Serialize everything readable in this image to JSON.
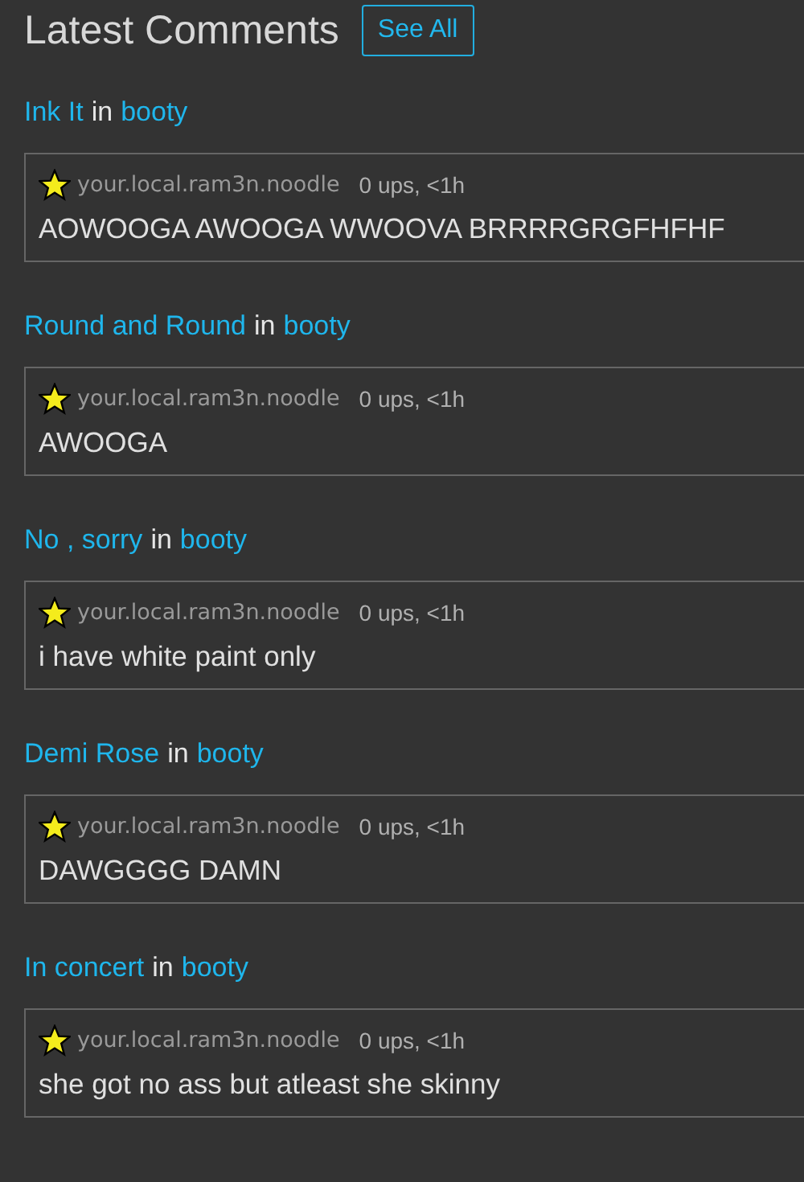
{
  "header": {
    "title": "Latest Comments",
    "button": "See All"
  },
  "comments": [
    {
      "meme_title": "Ink It",
      "joiner": "in",
      "stream": "booty",
      "user": "your.local.ram3n.noodle",
      "meta": "0 ups, <1h",
      "text": "AOWOOGA AWOOGA WWOOVA BRRRRGRGFHFHF"
    },
    {
      "meme_title": "Round and Round",
      "joiner": "in",
      "stream": "booty",
      "user": "your.local.ram3n.noodle",
      "meta": "0 ups, <1h",
      "text": "AWOOGA"
    },
    {
      "meme_title": "No , sorry",
      "joiner": "in",
      "stream": "booty",
      "user": "your.local.ram3n.noodle",
      "meta": "0 ups, <1h",
      "text": "i have white paint only"
    },
    {
      "meme_title": "Demi Rose",
      "joiner": "in",
      "stream": "booty",
      "user": "your.local.ram3n.noodle",
      "meta": "0 ups, <1h",
      "text": "DAWGGGG DAMN"
    },
    {
      "meme_title": "In concert",
      "joiner": "in",
      "stream": "booty",
      "user": "your.local.ram3n.noodle",
      "meta": "0 ups, <1h",
      "text": "she got no ass but atleast she skinny"
    }
  ]
}
